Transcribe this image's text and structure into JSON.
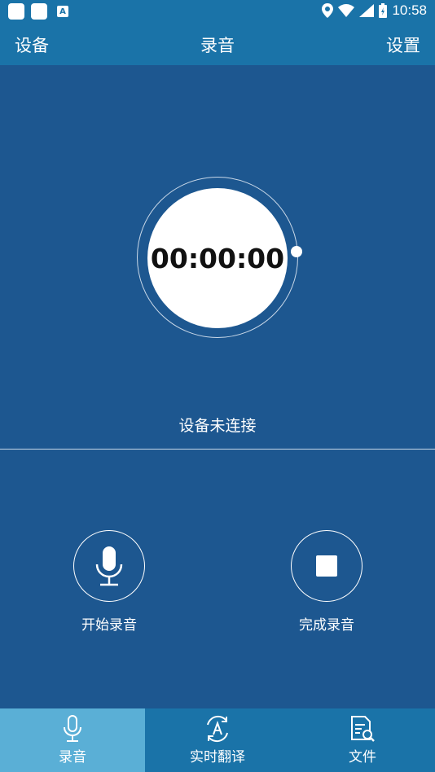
{
  "status_bar": {
    "time": "10:58"
  },
  "app_bar": {
    "left": "设备",
    "title": "录音",
    "right": "设置"
  },
  "timer": {
    "value": "00:00:00"
  },
  "device_status": "设备未连接",
  "controls": {
    "start_label": "开始录音",
    "finish_label": "完成录音"
  },
  "tabs": [
    {
      "label": "录音",
      "icon": "microphone-icon",
      "active": true
    },
    {
      "label": "实时翻译",
      "icon": "translate-icon",
      "active": false
    },
    {
      "label": "文件",
      "icon": "file-search-icon",
      "active": false
    }
  ],
  "colors": {
    "background": "#1d5790",
    "bar": "#1a73a8",
    "active_tab": "#5aafd6"
  }
}
